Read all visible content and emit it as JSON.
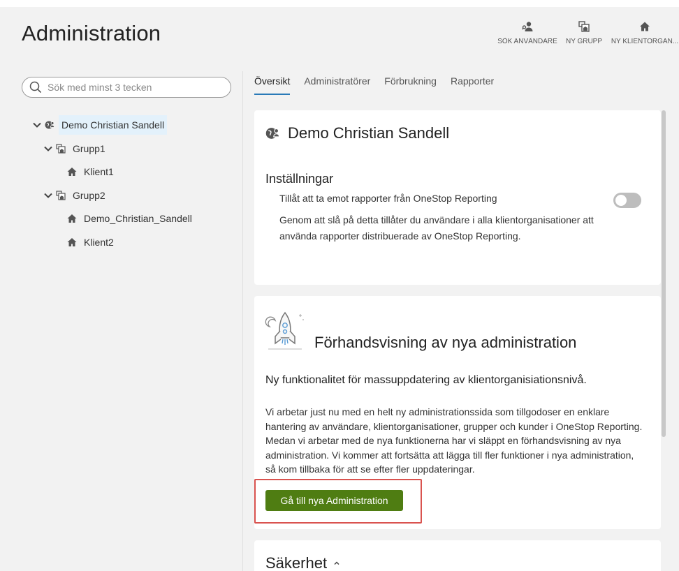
{
  "page": {
    "title": "Administration"
  },
  "actions": [
    {
      "label": "SÖK ANVÄNDARE",
      "icon": "user-search-icon"
    },
    {
      "label": "NY GRUPP",
      "icon": "group-add-icon"
    },
    {
      "label": "NY KLIENTORGAN...",
      "icon": "home-icon"
    }
  ],
  "search": {
    "placeholder": "Sök med minst 3 tecken",
    "value": ""
  },
  "tree": [
    {
      "label": "Demo Christian Sandell",
      "level": 0,
      "icon": "globe-user-icon",
      "expanded": true,
      "selected": true
    },
    {
      "label": "Grupp1",
      "level": 1,
      "icon": "group-icon",
      "expanded": true
    },
    {
      "label": "Klient1",
      "level": 2,
      "icon": "home-icon"
    },
    {
      "label": "Grupp2",
      "level": 1,
      "icon": "group-icon",
      "expanded": true
    },
    {
      "label": "Demo_Christian_Sandell",
      "level": 2,
      "icon": "home-icon"
    },
    {
      "label": "Klient2",
      "level": 2,
      "icon": "home-icon"
    }
  ],
  "tabs": [
    {
      "label": "Översikt",
      "active": true
    },
    {
      "label": "Administratörer"
    },
    {
      "label": "Förbrukning"
    },
    {
      "label": "Rapporter"
    }
  ],
  "org_card": {
    "title": "Demo Christian Sandell",
    "settings_heading": "Inställningar",
    "setting_label": "Tillåt att ta emot rapporter från OneStop Reporting",
    "setting_enabled": false,
    "setting_desc": "Genom att slå på detta tillåter du användare i alla klientorganisationer att använda rapporter distribuerade av OneStop Reporting."
  },
  "preview_card": {
    "title": "Förhandsvisning av nya administration",
    "subtitle": "Ny funktionalitet för massuppdatering av klientorganisiationsnivå.",
    "body": "Vi arbetar just nu med en helt ny administrationssida som tillgodoser en enklare hantering av användare, klientorganisationer, grupper och kunder i OneStop Reporting. Medan vi arbetar med de nya funktionerna har vi släppt en förhandsvisning av nya administration. Vi kommer att fortsätta att lägga till fler funktioner i nya administration, så kom tillbaka för att se efter fler uppdateringar.",
    "button_label": "Gå till nya Administration"
  },
  "security_card": {
    "title": "Säkerhet"
  },
  "colors": {
    "accent": "#2a7ab8",
    "button": "#4f7d12",
    "highlight": "#d9534f",
    "selected": "#e3f1fb"
  }
}
